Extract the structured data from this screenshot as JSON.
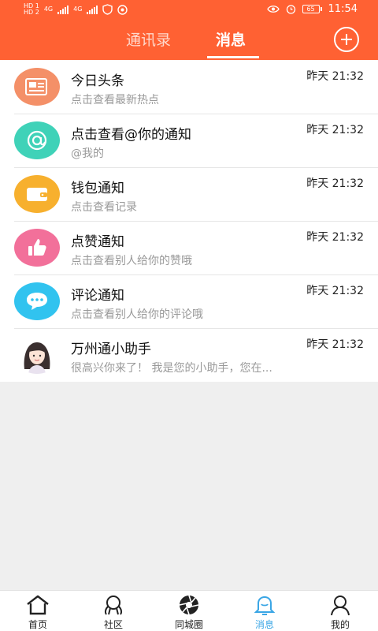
{
  "status_bar": {
    "sim1": "HD 1",
    "sim2": "HD 2",
    "net1": "4G",
    "net2": "4G",
    "battery": "65",
    "time": "11:54"
  },
  "header": {
    "tabs": [
      {
        "label": "通讯录"
      },
      {
        "label": "消息"
      }
    ],
    "active_tab": "消息",
    "accent": "#ff6133"
  },
  "messages": [
    {
      "title": "今日头条",
      "subtitle": "点击查看最新热点",
      "time": "昨天 21:32",
      "icon": "newspaper-icon",
      "color": "#f49068"
    },
    {
      "title": "点击查看@你的通知",
      "subtitle": "@我的",
      "time": "昨天 21:32",
      "icon": "at-icon",
      "color": "#3fd2b8"
    },
    {
      "title": "钱包通知",
      "subtitle": "点击查看记录",
      "time": "昨天 21:32",
      "icon": "wallet-icon",
      "color": "#f7b02e"
    },
    {
      "title": "点赞通知",
      "subtitle": "点击查看别人给你的赞哦",
      "time": "昨天 21:32",
      "icon": "thumbs-up-icon",
      "color": "#f2709a"
    },
    {
      "title": "评论通知",
      "subtitle": "点击查看别人给你的评论哦",
      "time": "昨天 21:32",
      "icon": "comment-icon",
      "color": "#31c3ef"
    },
    {
      "title": "万州通小助手",
      "subtitle": "很高兴你来了！ 我是您的小助手，您在...",
      "time": "昨天 21:32",
      "icon": "assistant-avatar",
      "color": "#ffffff"
    }
  ],
  "bottom_nav": {
    "items": [
      {
        "label": "首页",
        "icon": "home-icon"
      },
      {
        "label": "社区",
        "icon": "community-icon"
      },
      {
        "label": "同城圈",
        "icon": "aperture-icon"
      },
      {
        "label": "消息",
        "icon": "bell-icon"
      },
      {
        "label": "我的",
        "icon": "user-icon"
      }
    ],
    "active": "消息",
    "active_color": "#3aa6e5"
  }
}
